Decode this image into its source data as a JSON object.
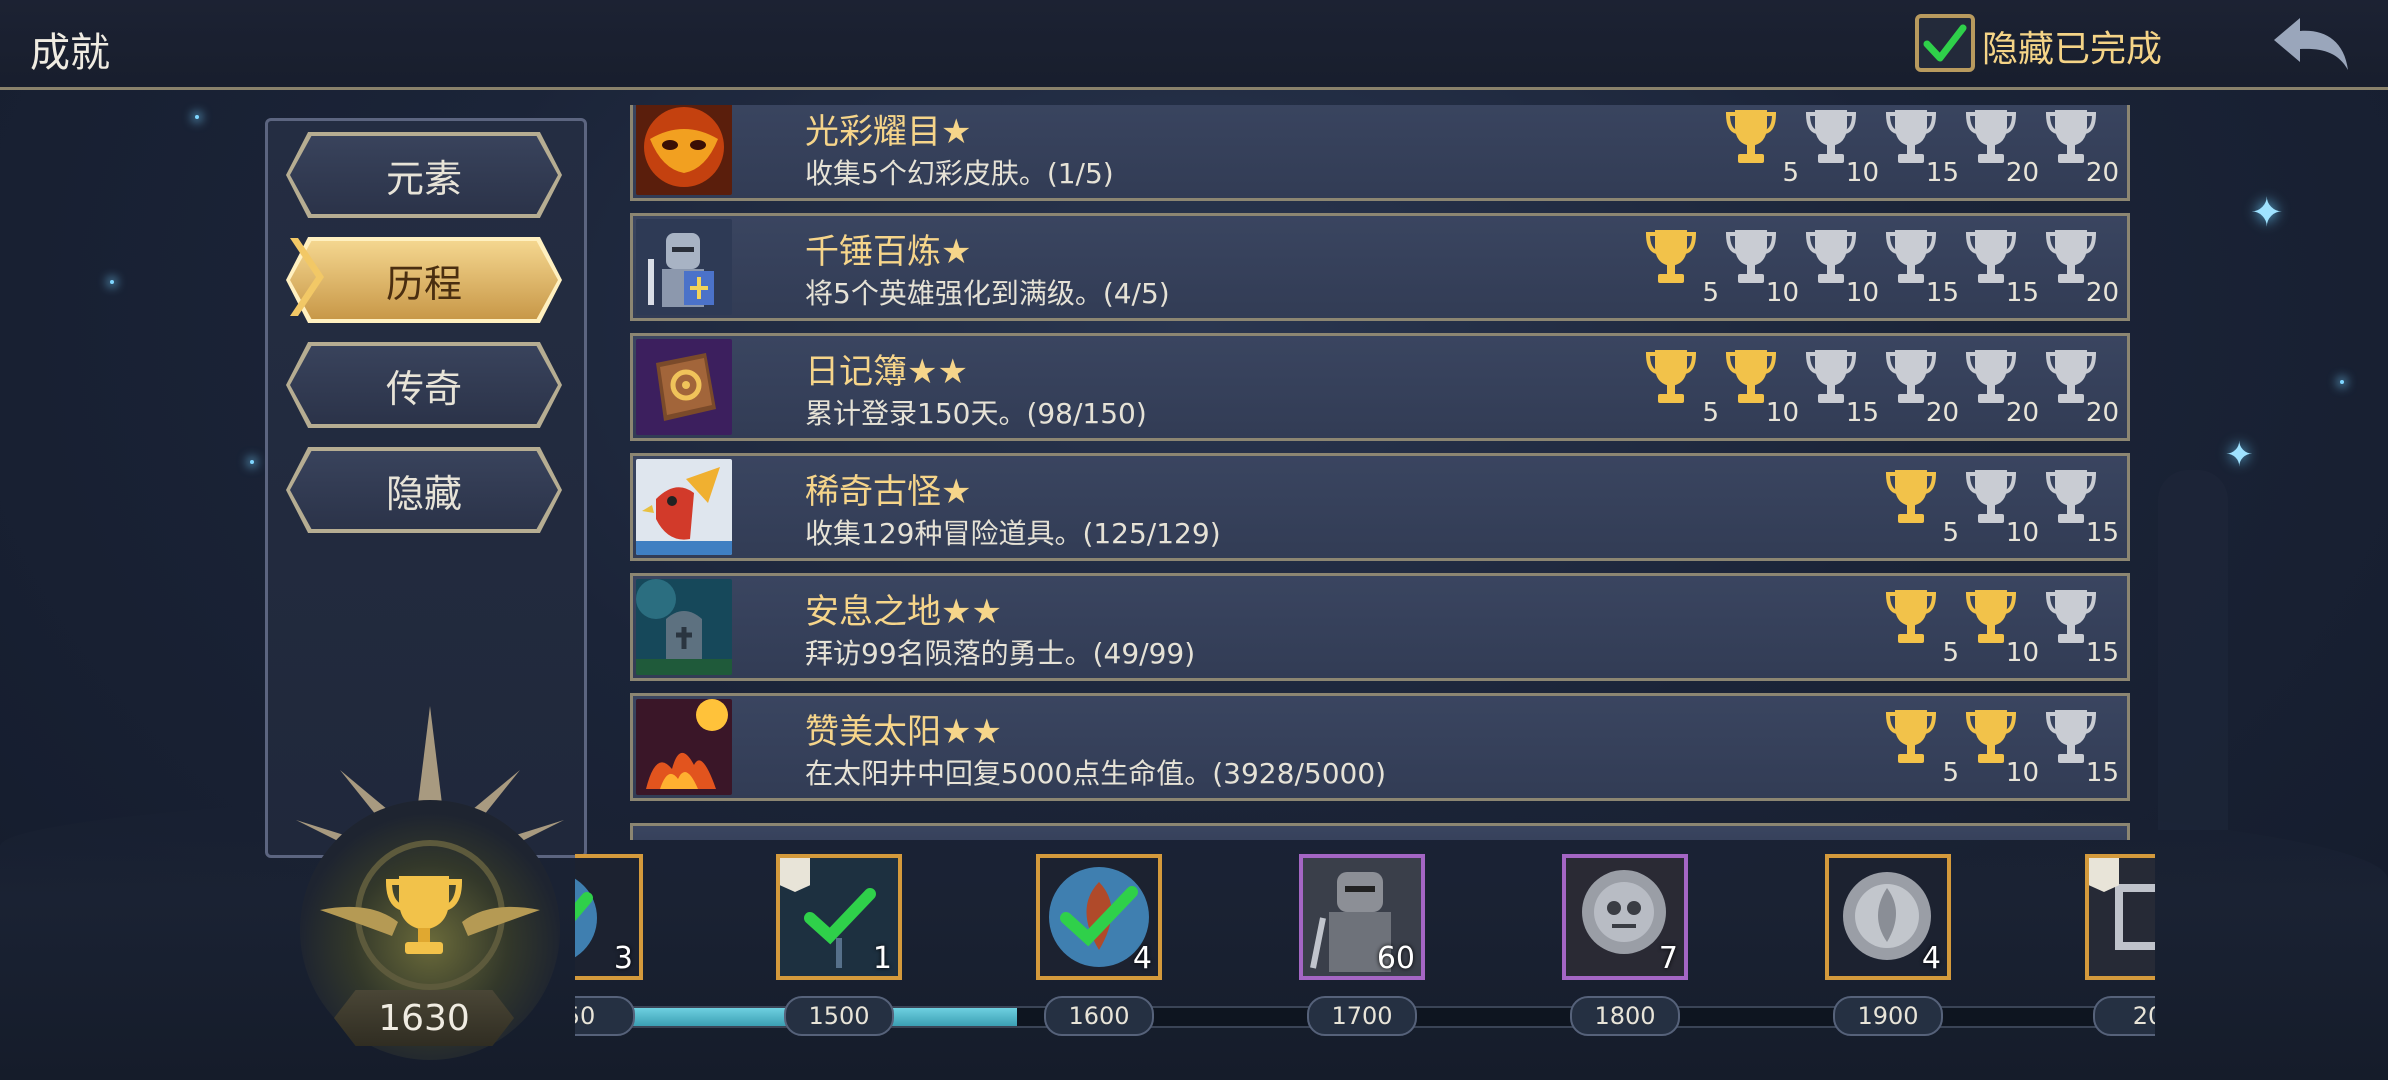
{
  "header": {
    "title": "成就",
    "hide_completed_label": "隐藏已完成",
    "hide_completed_checked": true
  },
  "categories": [
    {
      "label": "元素",
      "active": false
    },
    {
      "label": "历程",
      "active": true
    },
    {
      "label": "传奇",
      "active": false
    },
    {
      "label": "隐藏",
      "active": false
    }
  ],
  "achievements": [
    {
      "title": "光彩耀目★",
      "desc": "收集5个幻彩皮肤。(1/5)",
      "trophies": [
        {
          "n": "5",
          "gold": true
        },
        {
          "n": "10",
          "gold": false
        },
        {
          "n": "15",
          "gold": false
        },
        {
          "n": "20",
          "gold": false
        },
        {
          "n": "20",
          "gold": false
        }
      ]
    },
    {
      "title": "千锤百炼★",
      "desc": "将5个英雄强化到满级。(4/5)",
      "trophies": [
        {
          "n": "5",
          "gold": true
        },
        {
          "n": "10",
          "gold": false
        },
        {
          "n": "10",
          "gold": false
        },
        {
          "n": "15",
          "gold": false
        },
        {
          "n": "15",
          "gold": false
        },
        {
          "n": "20",
          "gold": false
        }
      ]
    },
    {
      "title": "日记簿★★",
      "desc": "累计登录150天。(98/150)",
      "trophies": [
        {
          "n": "5",
          "gold": true
        },
        {
          "n": "10",
          "gold": true
        },
        {
          "n": "15",
          "gold": false
        },
        {
          "n": "20",
          "gold": false
        },
        {
          "n": "20",
          "gold": false
        },
        {
          "n": "20",
          "gold": false
        }
      ]
    },
    {
      "title": "稀奇古怪★",
      "desc": "收集129种冒险道具。(125/129)",
      "trophies": [
        {
          "n": "5",
          "gold": true
        },
        {
          "n": "10",
          "gold": false
        },
        {
          "n": "15",
          "gold": false
        }
      ]
    },
    {
      "title": "安息之地★★",
      "desc": "拜访99名陨落的勇士。(49/99)",
      "trophies": [
        {
          "n": "5",
          "gold": true
        },
        {
          "n": "10",
          "gold": true
        },
        {
          "n": "15",
          "gold": false
        }
      ]
    },
    {
      "title": "赞美太阳★★",
      "desc": "在太阳井中回复5000点生命值。(3928/5000)",
      "trophies": [
        {
          "n": "5",
          "gold": true
        },
        {
          "n": "10",
          "gold": true
        },
        {
          "n": "15",
          "gold": false
        }
      ]
    }
  ],
  "score": {
    "value": "1630"
  },
  "progress": {
    "fill_fraction": 0.28,
    "ticks": [
      "50",
      "1500",
      "1600",
      "1700",
      "1800",
      "1900",
      "20"
    ],
    "rewards": [
      {
        "count": "3",
        "claimed": true,
        "frame": "orange"
      },
      {
        "count": "1",
        "claimed": true,
        "frame": "orange"
      },
      {
        "count": "4",
        "claimed": true,
        "frame": "orange"
      },
      {
        "count": "60",
        "claimed": false,
        "frame": "purple"
      },
      {
        "count": "7",
        "claimed": false,
        "frame": "purple"
      },
      {
        "count": "4",
        "claimed": false,
        "frame": "orange"
      },
      {
        "count": "",
        "claimed": false,
        "frame": "orange"
      }
    ]
  },
  "colors": {
    "gold": "#f2c24a",
    "silver": "#c9ccd3",
    "accent": "#f6d58a",
    "check": "#2fd04a"
  }
}
